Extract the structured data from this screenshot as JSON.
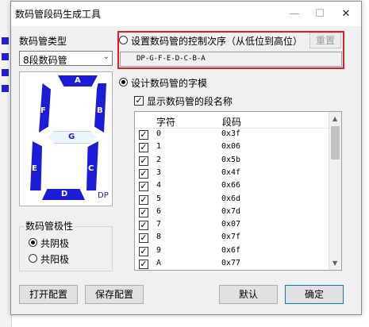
{
  "window": {
    "title": "数码管段码生成工具",
    "minimize_icon": "—",
    "maximize_icon": "☐",
    "close_icon": "✕"
  },
  "left": {
    "type_label": "数码管类型",
    "type_value": "8段数码管",
    "segment_labels": [
      "A",
      "B",
      "C",
      "D",
      "E",
      "F",
      "G",
      "DP"
    ],
    "polarity_label": "数码管极性",
    "common_cathode": "共阴极",
    "common_anode": "共阳极",
    "open_config": "打开配置",
    "save_config": "保存配置"
  },
  "right": {
    "order_radio_label": "设置数码管的控制次序（从低位到高位）",
    "reset_button": "重置",
    "order_value": "DP-G-F-E-D-C-B-A",
    "design_radio_label": "设计数码管的字模",
    "show_names_label": "显示数码管的段名称",
    "table": {
      "headers": [
        "字符",
        "段码"
      ],
      "rows": [
        {
          "char": "0",
          "code": "0x3f"
        },
        {
          "char": "1",
          "code": "0x06"
        },
        {
          "char": "2",
          "code": "0x5b"
        },
        {
          "char": "3",
          "code": "0x4f"
        },
        {
          "char": "4",
          "code": "0x66"
        },
        {
          "char": "5",
          "code": "0x6d"
        },
        {
          "char": "6",
          "code": "0x7d"
        },
        {
          "char": "7",
          "code": "0x07"
        },
        {
          "char": "8",
          "code": "0x7f"
        },
        {
          "char": "9",
          "code": "0x6f"
        },
        {
          "char": "A",
          "code": "0x77"
        }
      ]
    },
    "default_button": "默认",
    "ok_button": "确定"
  },
  "colors": {
    "segment": "#1b1bd8",
    "segment_off": "#eef4fb",
    "highlight": "#e02020"
  }
}
